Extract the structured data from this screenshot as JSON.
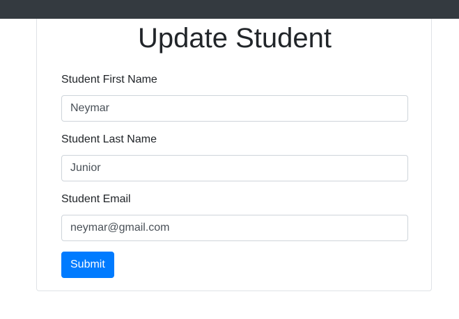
{
  "form": {
    "title": "Update Student",
    "first_name": {
      "label": "Student First Name",
      "value": "Neymar"
    },
    "last_name": {
      "label": "Student Last Name",
      "value": "Junior"
    },
    "email": {
      "label": "Student Email",
      "value": "neymar@gmail.com"
    },
    "submit_label": "Submit"
  },
  "colors": {
    "navbar": "#343a40",
    "primary": "#007bff"
  }
}
